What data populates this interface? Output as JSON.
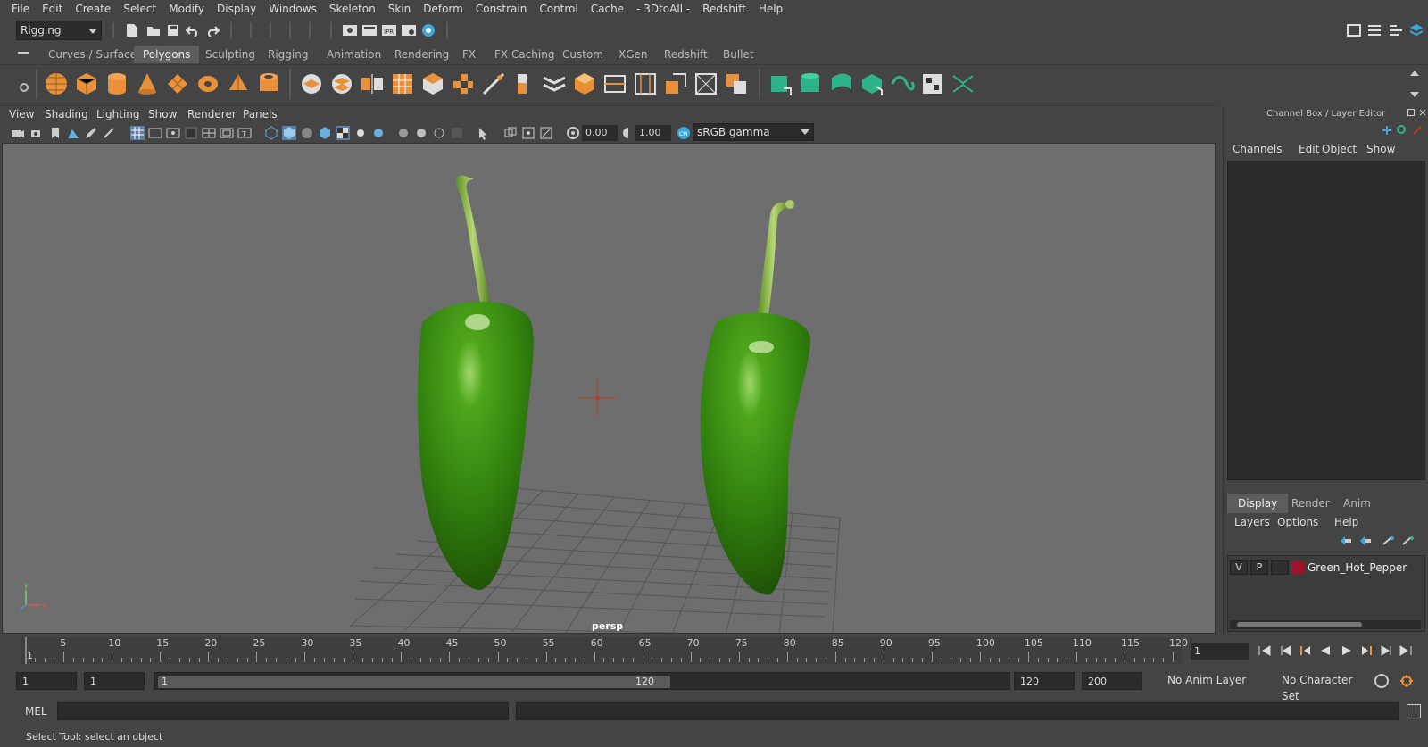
{
  "menubar": {
    "items": [
      "File",
      "Edit",
      "Create",
      "Select",
      "Modify",
      "Display",
      "Windows",
      "Skeleton",
      "Skin",
      "Deform",
      "Constrain",
      "Control",
      "Cache",
      "- 3DtoAll -",
      "Redshift",
      "Help"
    ]
  },
  "statusline": {
    "menuset": "Rigging"
  },
  "shelf": {
    "tabs": [
      "Curves / Surfaces",
      "Polygons",
      "Sculpting",
      "Rigging",
      "Animation",
      "Rendering",
      "FX",
      "FX Caching",
      "Custom",
      "XGen",
      "Redshift",
      "Bullet"
    ],
    "active_tab": "Polygons"
  },
  "viewport": {
    "menus": [
      "View",
      "Shading",
      "Lighting",
      "Show",
      "Renderer",
      "Panels"
    ],
    "exposure": "0.00",
    "gamma": "1.00",
    "colorspace": "sRGB gamma",
    "camera": "persp"
  },
  "channelbox": {
    "title": "Channel Box / Layer Editor",
    "menus": [
      "Channels",
      "Edit",
      "Object",
      "Show"
    ],
    "layer_tabs": [
      "Display",
      "Render",
      "Anim"
    ],
    "active_layer_tab": "Display",
    "layer_menus": [
      "Layers",
      "Options",
      "Help"
    ],
    "layer": {
      "visible": "V",
      "playback": "P",
      "name": "Green_Hot_Pepper",
      "color": "#a0122e"
    }
  },
  "timeline": {
    "ticks": [
      "1",
      "5",
      "10",
      "15",
      "20",
      "25",
      "30",
      "35",
      "40",
      "45",
      "50",
      "55",
      "60",
      "65",
      "70",
      "75",
      "80",
      "85",
      "90",
      "95",
      "100",
      "105",
      "110",
      "115",
      "120"
    ],
    "current_frame": "1"
  },
  "range": {
    "start": "1",
    "playback_start": "1",
    "slider_start": "1",
    "slider_end": "120",
    "playback_end": "120",
    "end": "200",
    "anim_layer": "No Anim Layer",
    "character_set": "No Character Set"
  },
  "commandline": {
    "label": "MEL"
  },
  "helpline": {
    "text": "Select Tool: select an object"
  }
}
